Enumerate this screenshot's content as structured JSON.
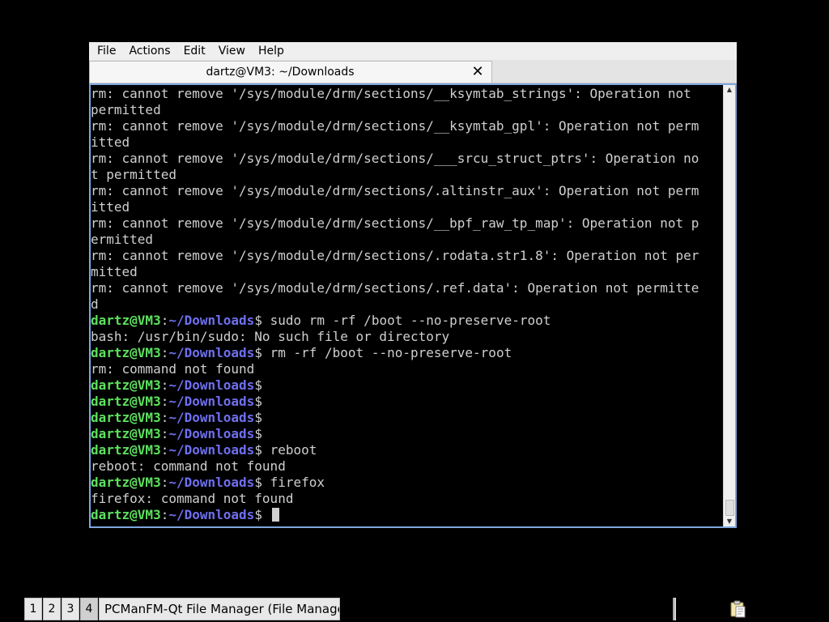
{
  "window": {
    "menu": [
      "File",
      "Actions",
      "Edit",
      "View",
      "Help"
    ],
    "tab_title": "dartz@VM3: ~/Downloads",
    "tab_close": "✕"
  },
  "terminal": {
    "prompt_user": "dartz@VM3",
    "prompt_sep": ":",
    "prompt_path": "~/Downloads",
    "prompt_end": "$",
    "lines": [
      {
        "type": "out",
        "text": "rm: cannot remove '/sys/module/drm/sections/__ksymtab_strings': Operation not"
      },
      {
        "type": "out",
        "text": "permitted"
      },
      {
        "type": "out",
        "text": "rm: cannot remove '/sys/module/drm/sections/__ksymtab_gpl': Operation not perm"
      },
      {
        "type": "out",
        "text": "itted"
      },
      {
        "type": "out",
        "text": "rm: cannot remove '/sys/module/drm/sections/___srcu_struct_ptrs': Operation no"
      },
      {
        "type": "out",
        "text": "t permitted"
      },
      {
        "type": "out",
        "text": "rm: cannot remove '/sys/module/drm/sections/.altinstr_aux': Operation not perm"
      },
      {
        "type": "out",
        "text": "itted"
      },
      {
        "type": "out",
        "text": "rm: cannot remove '/sys/module/drm/sections/__bpf_raw_tp_map': Operation not p"
      },
      {
        "type": "out",
        "text": "ermitted"
      },
      {
        "type": "out",
        "text": "rm: cannot remove '/sys/module/drm/sections/.rodata.str1.8': Operation not per"
      },
      {
        "type": "out",
        "text": "mitted"
      },
      {
        "type": "out",
        "text": "rm: cannot remove '/sys/module/drm/sections/.ref.data': Operation not permitte"
      },
      {
        "type": "out",
        "text": "d"
      },
      {
        "type": "prompt",
        "text": " sudo rm -rf /boot --no-preserve-root"
      },
      {
        "type": "out",
        "text": "bash: /usr/bin/sudo: No such file or directory"
      },
      {
        "type": "prompt",
        "text": " rm -rf /boot --no-preserve-root"
      },
      {
        "type": "out",
        "text": "rm: command not found"
      },
      {
        "type": "prompt",
        "text": ""
      },
      {
        "type": "prompt",
        "text": ""
      },
      {
        "type": "prompt",
        "text": ""
      },
      {
        "type": "prompt",
        "text": ""
      },
      {
        "type": "prompt",
        "text": " reboot"
      },
      {
        "type": "out",
        "text": "reboot: command not found"
      },
      {
        "type": "prompt",
        "text": " firefox"
      },
      {
        "type": "out",
        "text": "firefox: command not found"
      },
      {
        "type": "prompt",
        "text": " ",
        "cursor": true
      }
    ]
  },
  "taskbar": {
    "desktops": [
      "1",
      "2",
      "3",
      "4"
    ],
    "active_desktop": 3,
    "task_label": "PCManFM-Qt File Manager (File Manager)",
    "tray_icon": "clipboard-icon"
  }
}
